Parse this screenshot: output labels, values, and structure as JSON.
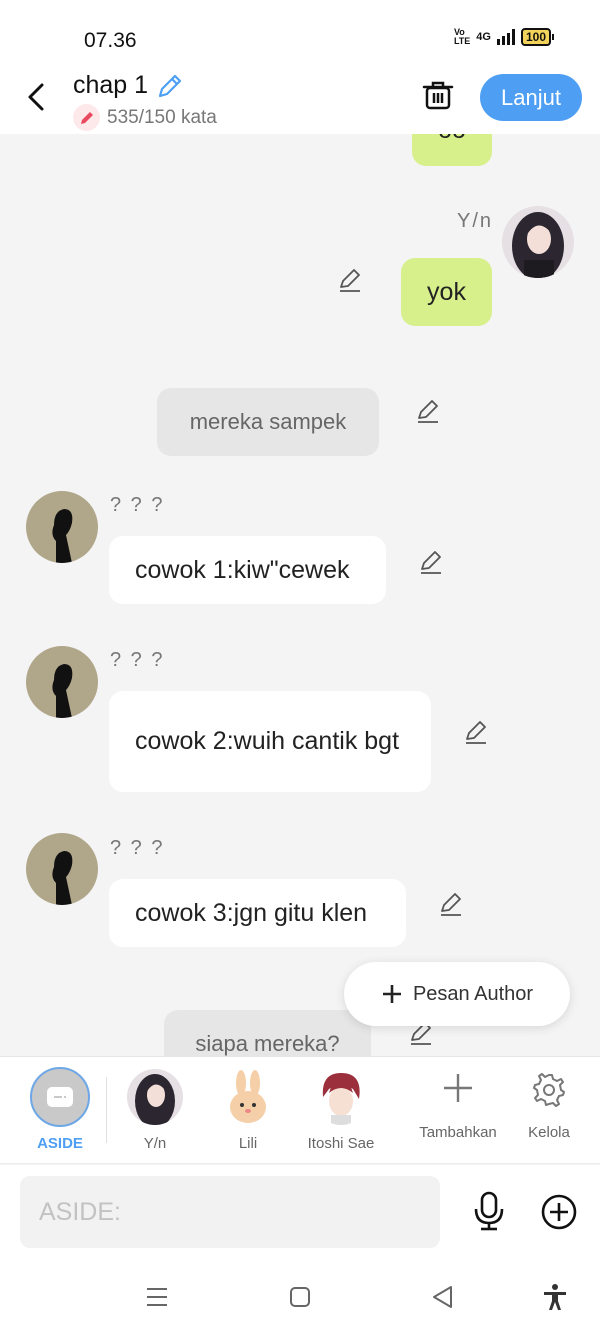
{
  "status_bar": {
    "time": "07.36",
    "volte_top": "Vo",
    "volte_bottom": "LTE",
    "network": "4G",
    "battery": "100"
  },
  "header": {
    "title": "chap 1",
    "word_count": "535/150 kata",
    "next_button": "Lanjut"
  },
  "messages": [
    {
      "type": "self",
      "text": "oo",
      "partial": true
    },
    {
      "type": "self",
      "sender": "Y/n",
      "text": "yok"
    },
    {
      "type": "aside",
      "text": "mereka sampek"
    },
    {
      "type": "other",
      "sender": "? ? ?",
      "text": "cowok 1:kiw\"cewek"
    },
    {
      "type": "other",
      "sender": "? ? ?",
      "text": "cowok 2:wuih cantik bgt"
    },
    {
      "type": "other",
      "sender": "? ? ?",
      "text": "cowok 3:jgn gitu klen"
    },
    {
      "type": "aside",
      "text": "siapa mereka?",
      "partial": true
    }
  ],
  "fab": {
    "label": "Pesan Author"
  },
  "characters": [
    {
      "label": "ASIDE",
      "selected": true
    },
    {
      "label": "Y/n"
    },
    {
      "label": "Lili"
    },
    {
      "label": "Itoshi Sae"
    },
    {
      "label": "Tambahkan"
    },
    {
      "label": "Kelola"
    }
  ],
  "composer": {
    "placeholder": "ASIDE:"
  },
  "colors": {
    "accent": "#4e9ff3",
    "self_bubble": "#d7f08b",
    "aside_bubble": "#e6e6e6",
    "background": "#f4f4f4"
  },
  "icons": [
    "back-arrow-icon",
    "pencil-icon",
    "trash-icon",
    "plus-icon",
    "mic-icon",
    "plus-circle-icon",
    "gear-icon",
    "menu-icon",
    "home-square-icon",
    "back-triangle-icon",
    "accessibility-icon"
  ]
}
